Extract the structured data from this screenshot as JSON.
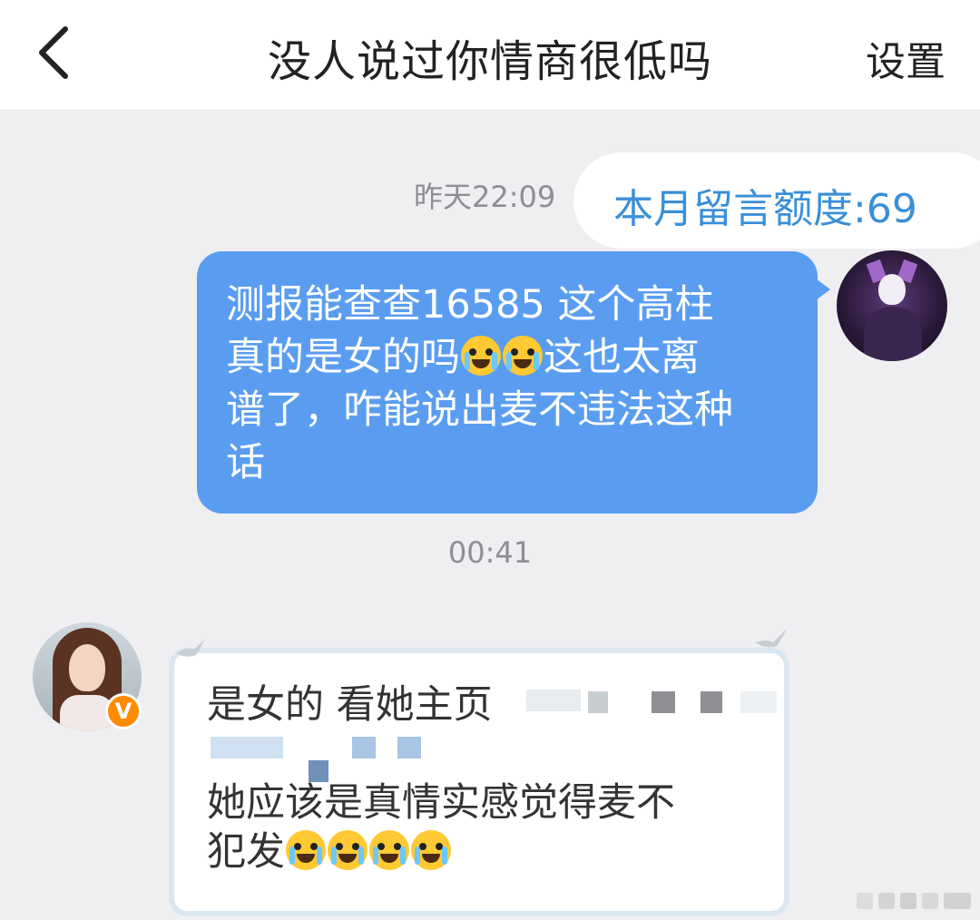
{
  "header": {
    "title": "没人说过你情商很低吗",
    "settings_label": "设置"
  },
  "messages": {
    "ts1": "昨天22:09",
    "quota": "本月留言额度:69",
    "me_lines": [
      "测报能查查16585 这个高柱",
      "真的是女的吗",
      "这也太离",
      "谱了，咋能说出麦不违法这种",
      "话"
    ],
    "ts2": "00:41",
    "her_lines": [
      "是女的 看她主页",
      "她应该是真情实感觉得麦不",
      "犯发"
    ]
  },
  "colors": {
    "accent": "#5a9df0",
    "quota_text": "#3a8fd8",
    "badge": "#ff8a00"
  },
  "icons": {
    "back": "chevron-left-icon",
    "emoji": "crying-laughing-emoji",
    "badge": "verified-v-icon"
  }
}
